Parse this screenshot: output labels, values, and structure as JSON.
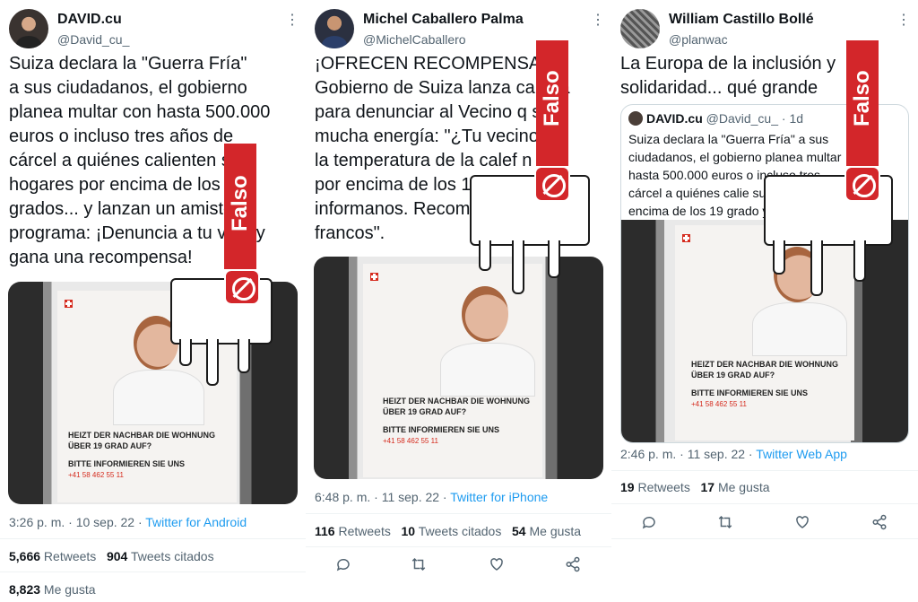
{
  "tweets": [
    {
      "name": "DAVID.cu",
      "handle": "@David_cu_",
      "text": "Suiza declara la \"Guerra Fría\"\na sus ciudadanos, el gobierno\nplanea multar con hasta 500.000\neuros o incluso tres años de\ncárcel a quiénes calienten s\nhogares por encima de los \ngrados... y lanzan un amisto\nprograma: ¡Denuncia a tu ve o y\ngana una recompensa!",
      "poster": {
        "line1": "HEIZT DER NACHBAR DIE WOHNUNG",
        "line2": "ÜBER 19 GRAD AUF?",
        "line3": "BITTE INFORMIEREN SIE UNS",
        "phone": "+41 58 462 55 11"
      },
      "time": "3:26 p. m. · 10 sep. 22 · ",
      "source": "Twitter for Android",
      "retweets": "5,666",
      "retweets_label": " Retweets",
      "quotes": "904",
      "quotes_label": " Tweets citados",
      "likes": "8,823",
      "likes_label": " Me gusta"
    },
    {
      "name": "Michel Caballero Palma",
      "handle": "@MichelCaballero",
      "text": "¡OFRECEN RECOMPENSA\nGobierno de Suiza lanza ca aña\npara denunciar al Vecino q sa\nmucha energía: \"¿Tu vecino e\nla temperatura de la calef n\npor encima de los 19º? Po r,\ninformanos. Recompensa 0\nfrancos\".",
      "poster": {
        "line1": "HEIZT DER NACHBAR DIE WOHNUNG",
        "line2": "ÜBER 19 GRAD AUF?",
        "line3": "BITTE INFORMIEREN SIE UNS",
        "phone": "+41 58 462 55 11"
      },
      "time": "6:48 p. m. · 11 sep. 22 · ",
      "source": "Twitter for iPhone",
      "retweets": "116",
      "retweets_label": " Retweets",
      "quotes": "10",
      "quotes_label": " Tweets citados",
      "likes": "54",
      "likes_label": " Me gusta"
    },
    {
      "name": "William Castillo Bollé",
      "handle": "@planwac",
      "text": "La Europa de la inclusión y\nsolidaridad... qué grande",
      "quote": {
        "name": "DAVID.cu",
        "handle": "@David_cu_ · 1d",
        "text": "Suiza declara la \"Guerra Fría\" a sus\nciudadanos, el gobierno planea multar\nhasta 500.000 euros o incluso tres\ncárcel a quiénes calie sus hogares\nencima de los 19 grado y lanzan u"
      },
      "poster": {
        "line1": "HEIZT DER NACHBAR DIE WOHNUNG",
        "line2": "ÜBER 19 GRAD AUF?",
        "line3": "BITTE INFORMIEREN SIE UNS",
        "phone": "+41 58 462 55 11"
      },
      "time": "2:46 p. m. · 11 sep. 22 · ",
      "source": "Twitter Web App",
      "retweets": "19",
      "retweets_label": " Retweets",
      "likes": "17",
      "likes_label": " Me gusta"
    }
  ],
  "stamp_word": "Falso",
  "icons": [
    "more-icon",
    "reply-icon",
    "retweet-icon",
    "like-icon",
    "share-icon",
    "prohibited-icon"
  ],
  "colors": {
    "link": "#1d9bf0",
    "stamp": "#d3262a",
    "muted": "#536471"
  }
}
